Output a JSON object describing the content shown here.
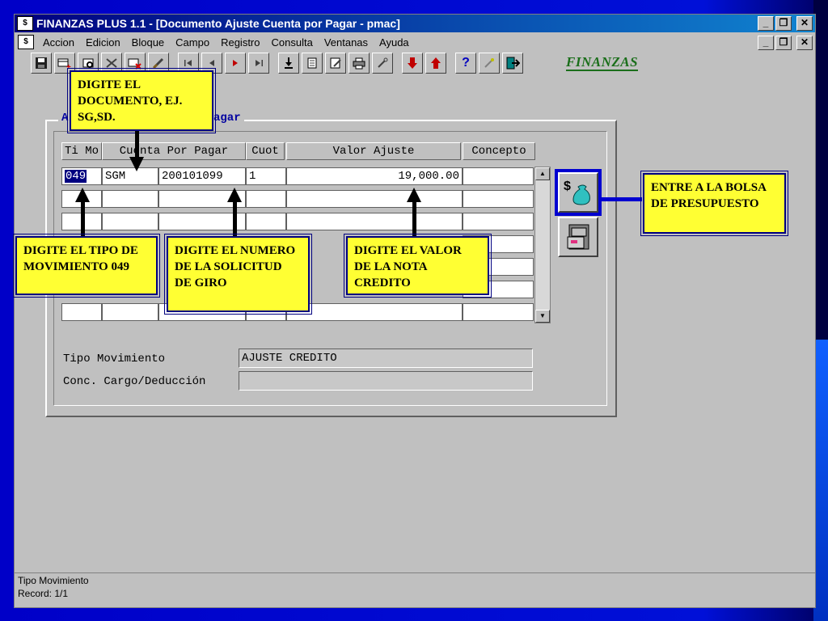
{
  "window": {
    "title": "FINANZAS PLUS 1.1 - [Documento Ajuste Cuenta por Pagar - pmac]",
    "controls": {
      "minimize": "_",
      "restore": "❐",
      "close": "✕"
    }
  },
  "menu": [
    {
      "label": "Accion"
    },
    {
      "label": "Edicion"
    },
    {
      "label": "Bloque"
    },
    {
      "label": "Campo"
    },
    {
      "label": "Registro"
    },
    {
      "label": "Consulta"
    },
    {
      "label": "Ventanas"
    },
    {
      "label": "Ayuda"
    }
  ],
  "toolbar": {
    "logo": "FINANZAS",
    "help": "?",
    "icons": [
      "save-icon",
      "new-record-icon",
      "print-query-icon",
      "list-icon",
      "delete-icon",
      "clear-icon",
      "first-record-icon",
      "previous-record-icon",
      "next-record-icon",
      "last-record-icon",
      "download-icon",
      "document-icon",
      "edit-icon",
      "printer-icon",
      "tools-icon",
      "arrow-down-icon",
      "arrow-up-icon",
      "help-icon",
      "wand-icon",
      "exit-icon"
    ]
  },
  "form": {
    "block_title_a": "A",
    "block_title_b": "agar",
    "headers": {
      "ti_mo": "Ti Mo",
      "cuenta": "Cuenta Por Pagar",
      "cuot": "Cuot",
      "valor": "Valor Ajuste",
      "concepto": "Concepto"
    },
    "row1": {
      "ti_mo": "049",
      "cuenta_a": "SGM",
      "cuenta_b": "200101099",
      "cuot": "1",
      "valor": "19,000.00",
      "concepto": ""
    },
    "tipo_label": "Tipo Movimiento",
    "tipo_value": "AJUSTE CREDITO",
    "conc_label": "Conc. Cargo/Deducción",
    "conc_value": ""
  },
  "status": {
    "line1": "Tipo Movimiento",
    "line2": "Record: 1/1"
  },
  "callouts": {
    "documento": "DIGITE EL DOCUMENTO, EJ. SG,SD.",
    "tipo": "DIGITE EL TIPO DE MOVIMIENTO 049",
    "numero": "DIGITE EL NUMERO DE LA SOLICITUD DE GIRO",
    "valor": "DIGITE EL VALOR DE LA NOTA CREDITO",
    "bolsa": "ENTRE A LA BOLSA DE PRESUPUESTO"
  }
}
